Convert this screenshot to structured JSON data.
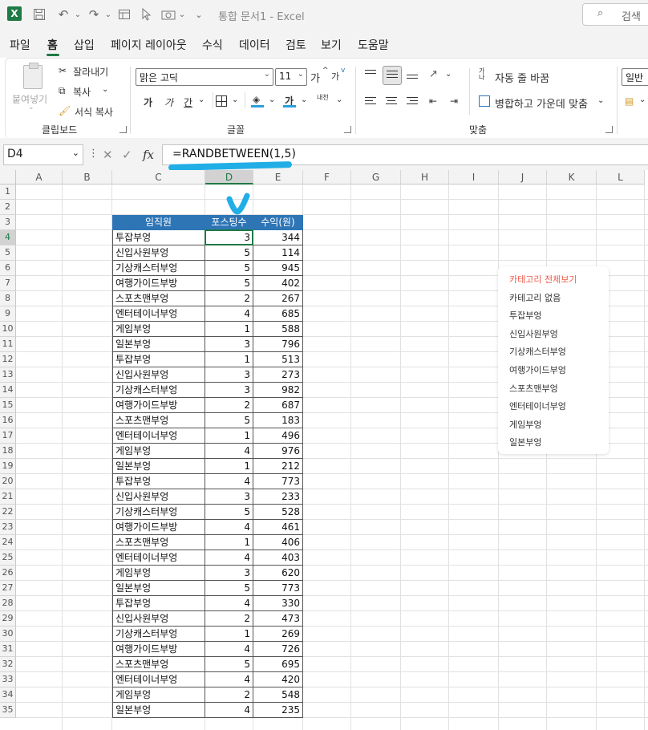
{
  "titlebar": {
    "doc_title": "통합 문서1  -  Excel",
    "search_label": "검색",
    "icons": [
      "excel-logo",
      "save-icon",
      "undo-icon",
      "redo-icon",
      "form-icon",
      "pointer-icon",
      "camera-icon",
      "customize-chevron-icon",
      "search-icon"
    ]
  },
  "menu": {
    "items": [
      "파일",
      "홈",
      "삽입",
      "페이지 레이아웃",
      "수식",
      "데이터",
      "검토",
      "보기",
      "도움말"
    ],
    "active": "홈"
  },
  "ribbon": {
    "clipboard": {
      "paste": "붙여넣기",
      "cut": "잘라내기",
      "copy": "복사",
      "format_painter": "서식 복사",
      "label": "클립보드"
    },
    "font": {
      "font_name": "맑은 고딕",
      "font_size": "11",
      "grow": "가",
      "shrink": "가",
      "bold": "가",
      "italic": "가",
      "underline": "간",
      "font_color": "가",
      "phonetic": "내천",
      "label": "글꼴"
    },
    "alignment": {
      "wrap_text": "자동 줄 바꿈",
      "merge_center": "병합하고 가운데 맞춤",
      "label": "맞춤"
    },
    "number": {
      "format": "일반"
    }
  },
  "formula_bar": {
    "name_box": "D4",
    "fx": "fx",
    "formula": "=RANDBETWEEN(1,5)"
  },
  "sheet": {
    "columns": [
      "A",
      "B",
      "C",
      "D",
      "E",
      "F",
      "G",
      "H",
      "I",
      "J",
      "K",
      "L"
    ],
    "row_numbers": [
      "1",
      "2",
      "3",
      "4",
      "5",
      "6",
      "7",
      "8",
      "9",
      "10",
      "11",
      "12",
      "13",
      "14",
      "15",
      "16",
      "17",
      "18",
      "19",
      "20",
      "21",
      "22",
      "23",
      "24",
      "25",
      "26",
      "27",
      "28",
      "29",
      "30",
      "31",
      "32",
      "33",
      "34",
      "35"
    ],
    "table_headers": [
      "임직원",
      "포스팅수",
      "수익(원)"
    ],
    "table_rows": [
      [
        "투잡부엉",
        "3",
        "344"
      ],
      [
        "신입사원부엉",
        "5",
        "114"
      ],
      [
        "기상캐스터부엉",
        "5",
        "945"
      ],
      [
        "여행가이드부방",
        "5",
        "402"
      ],
      [
        "스포츠맨부엉",
        "2",
        "267"
      ],
      [
        "엔터테이너부엉",
        "4",
        "685"
      ],
      [
        "게임부엉",
        "1",
        "588"
      ],
      [
        "일본부엉",
        "3",
        "796"
      ],
      [
        "투잡부엉",
        "1",
        "513"
      ],
      [
        "신입사원부엉",
        "3",
        "273"
      ],
      [
        "기상캐스터부엉",
        "3",
        "982"
      ],
      [
        "여행가이드부방",
        "2",
        "687"
      ],
      [
        "스포츠맨부엉",
        "5",
        "183"
      ],
      [
        "엔터테이너부엉",
        "1",
        "496"
      ],
      [
        "게임부엉",
        "4",
        "976"
      ],
      [
        "일본부엉",
        "1",
        "212"
      ],
      [
        "투잡부엉",
        "4",
        "773"
      ],
      [
        "신입사원부엉",
        "3",
        "233"
      ],
      [
        "기상캐스터부엉",
        "5",
        "528"
      ],
      [
        "여행가이드부방",
        "4",
        "461"
      ],
      [
        "스포츠맨부엉",
        "1",
        "406"
      ],
      [
        "엔터테이너부엉",
        "4",
        "403"
      ],
      [
        "게임부엉",
        "3",
        "620"
      ],
      [
        "일본부엉",
        "5",
        "773"
      ],
      [
        "투잡부엉",
        "4",
        "330"
      ],
      [
        "신입사원부엉",
        "2",
        "473"
      ],
      [
        "기상캐스터부엉",
        "1",
        "269"
      ],
      [
        "여행가이드부방",
        "4",
        "726"
      ],
      [
        "스포츠맨부엉",
        "5",
        "695"
      ],
      [
        "엔터테이너부엉",
        "4",
        "420"
      ],
      [
        "게임부엉",
        "2",
        "548"
      ],
      [
        "일본부엉",
        "4",
        "235"
      ]
    ]
  },
  "category_popup": {
    "items": [
      "카테고리 전체보기",
      "카테고리 없음",
      "투잡부엉",
      "신입사원부엉",
      "기상캐스터부엉",
      "여행가이드부엉",
      "스포츠맨부엉",
      "엔터테이너부엉",
      "게임부엉",
      "일본부엉"
    ]
  },
  "colors": {
    "header_fill": "#2e75b6",
    "excel_green": "#1f7a45",
    "marker_blue": "#21aee6",
    "popup_accent": "#ef5b4c"
  }
}
